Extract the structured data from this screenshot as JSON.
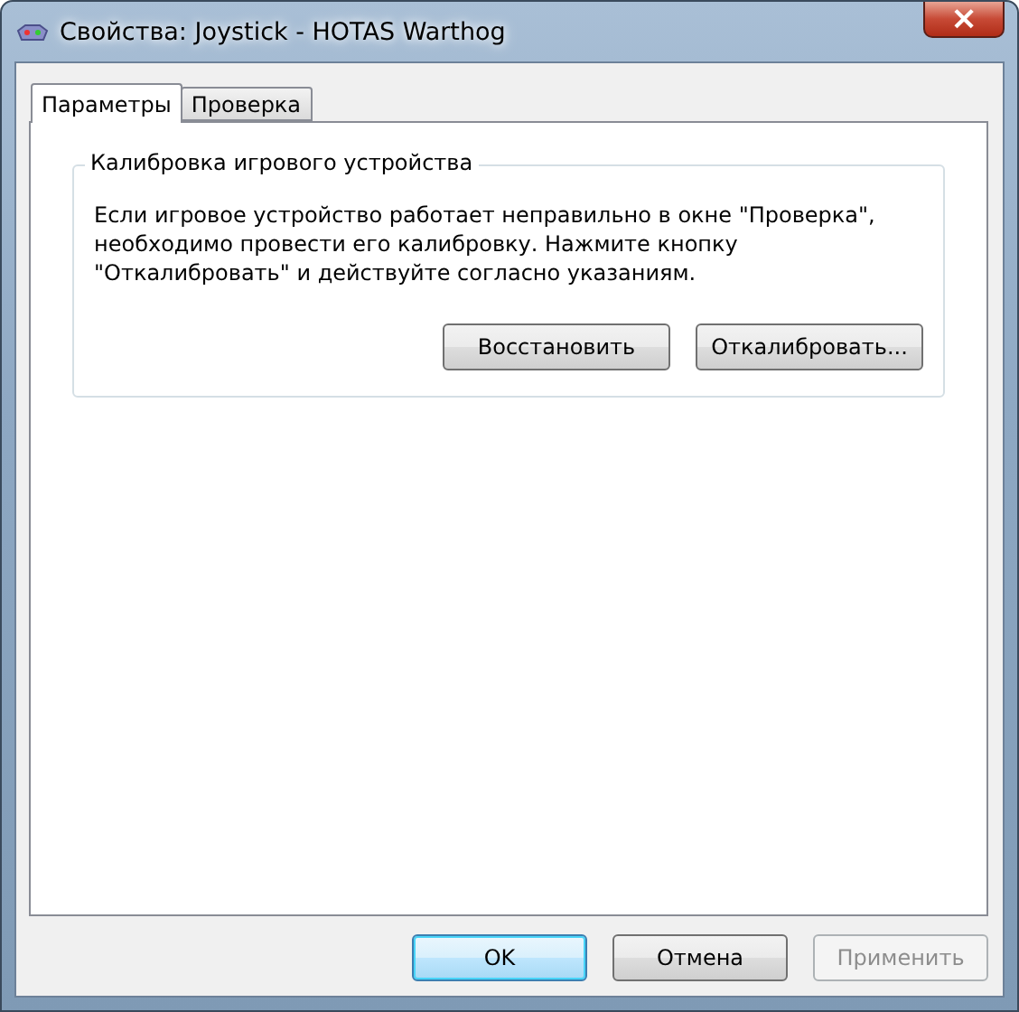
{
  "window": {
    "title": "Свойства: Joystick - HOTAS Warthog",
    "close": "×"
  },
  "tabs": [
    {
      "label": "Параметры",
      "selected": true
    },
    {
      "label": "Проверка",
      "selected": false
    }
  ],
  "group": {
    "title": "Калибровка игрового устройства",
    "text": "Если игровое устройство работает неправильно в окне \"Проверка\", необходимо провести его калибровку. Нажмите кнопку \"Откалибровать\" и действуйте согласно указаниям.",
    "buttons": [
      {
        "label": "Восстановить",
        "disabled": false,
        "default": false
      },
      {
        "label": "Откалибровать...",
        "disabled": false,
        "default": false
      }
    ]
  },
  "buttons": [
    {
      "label": "OK",
      "disabled": false,
      "default": true
    },
    {
      "label": "Отмена",
      "disabled": false,
      "default": false
    },
    {
      "label": "Применить",
      "disabled": true,
      "default": false
    }
  ]
}
